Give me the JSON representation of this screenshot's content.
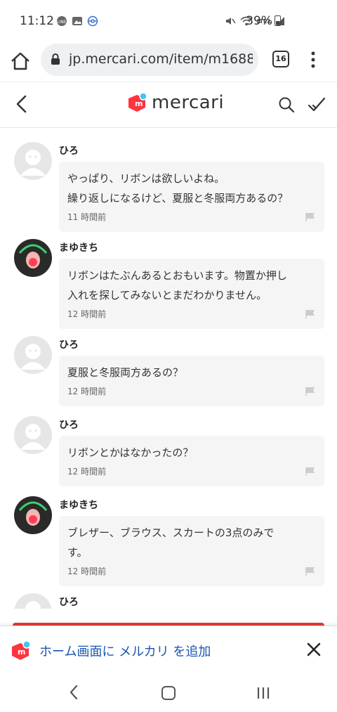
{
  "status": {
    "time": "11:12",
    "battery": "39%",
    "network": "LTE1"
  },
  "browser": {
    "url": "jp.mercari.com/item/m1688",
    "tab_count": "16"
  },
  "header": {
    "logo_text": "mercari",
    "brand_color": "#ff333f"
  },
  "comments": [
    {
      "user": "ひろ",
      "avatar": "default",
      "text": "やっぱり、リボンは欲しいよね。\n繰り返しになるけど、夏服と冬服両方あるの？",
      "time": "11 時間前"
    },
    {
      "user": "まゆきち",
      "avatar": "photo",
      "text": "リボンはたぶんあるとおもいます。物置か押し\n入れを探してみないとまだわかりません。",
      "time": "12 時間前"
    },
    {
      "user": "ひろ",
      "avatar": "default",
      "text": "夏服と冬服両方あるの？",
      "time": "12 時間前"
    },
    {
      "user": "ひろ",
      "avatar": "default",
      "text": "リボンとかはなかったの？",
      "time": "12 時間前"
    },
    {
      "user": "まゆきち",
      "avatar": "photo",
      "text": "ブレザー、ブラウス、スカートの3点のみで\nす。",
      "time": "12 時間前"
    },
    {
      "user": "ひろ",
      "avatar": "default",
      "text": "",
      "time": ""
    }
  ],
  "add_to_home": {
    "text": "ホーム画面に メルカリ を追加"
  }
}
